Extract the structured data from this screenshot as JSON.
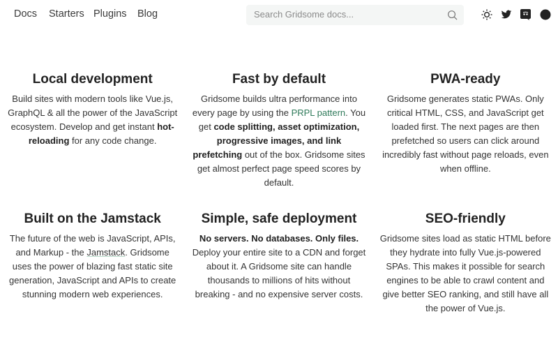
{
  "nav": {
    "links": [
      "Docs",
      "Starters",
      "Plugins",
      "Blog"
    ],
    "search_placeholder": "Search Gridsome docs..."
  },
  "colors": {
    "link": "#2f7a5a",
    "text": "#333333"
  },
  "features": [
    {
      "title": "Local development",
      "lines": [
        [
          {
            "t": "Build sites with modern tools like"
          }
        ],
        [
          {
            "t": "Vue.js, ",
            "s": ""
          },
          {
            "t": "GraphQL & all the power of"
          }
        ],
        [
          {
            "t": "the JavaScript ecosystem. Develop"
          }
        ],
        [
          {
            "t": "and get instant "
          },
          {
            "t": "hot-reloading",
            "s": "b"
          },
          {
            "t": " for any"
          }
        ],
        [
          {
            "t": "code change."
          }
        ]
      ]
    },
    {
      "title": "Fast by default",
      "lines": [
        [
          {
            "t": "Gridsome builds ultra performance into every"
          }
        ],
        [
          {
            "t": "page by using the "
          },
          {
            "t": "PRPL pattern",
            "s": "l"
          },
          {
            "t": ". You get "
          },
          {
            "t": "code",
            "s": "b"
          }
        ],
        [
          {
            "t": "splitting, asset optimization, progressive",
            "s": "b"
          }
        ],
        [
          {
            "t": "images, and link prefetching",
            "s": "b"
          },
          {
            "t": " out of the box."
          }
        ],
        [
          {
            "t": "Gridsome sites get almost perfect page speed"
          }
        ],
        [
          {
            "t": "scores by default."
          }
        ]
      ]
    },
    {
      "title": "PWA-ready",
      "lines": [
        [
          {
            "t": "Gridsome generates static PWAs. Only critical"
          }
        ],
        [
          {
            "t": "HTML, CSS, and JavaScript get loaded first."
          }
        ],
        [
          {
            "t": "The next pages are then prefetched so users"
          }
        ],
        [
          {
            "t": "can click around incredibly fast without page"
          }
        ],
        [
          {
            "t": "reloads, even when offline."
          }
        ]
      ]
    },
    {
      "title": "Built on the Jamstack",
      "lines": [
        [
          {
            "t": "The future of the web is JavaScript, APIs, and"
          }
        ],
        [
          {
            "t": "Markup - the "
          },
          {
            "t": "Jamstack",
            "s": "u"
          },
          {
            "t": ". Gridsome uses the"
          }
        ],
        [
          {
            "t": "power of blazing fast static site generation,"
          }
        ],
        [
          {
            "t": "JavaScript and APIs to create stunning modern"
          }
        ],
        [
          {
            "t": "web experiences."
          }
        ]
      ]
    },
    {
      "title": "Simple, safe deployment",
      "lines": [
        [
          {
            "t": "No servers. No databases. Only files.",
            "s": "b"
          },
          {
            "t": " Deploy"
          }
        ],
        [
          {
            "t": "your entire site to a CDN and forget about it."
          }
        ],
        [
          {
            "t": "A Gridsome site can handle thousands to"
          }
        ],
        [
          {
            "t": "millions of hits without breaking - and no"
          }
        ],
        [
          {
            "t": "expensive server costs."
          }
        ]
      ]
    },
    {
      "title": "SEO-friendly",
      "lines": [
        [
          {
            "t": "Gridsome sites load as static HTML before"
          }
        ],
        [
          {
            "t": "they hydrate into fully Vue.js-powered SPAs."
          }
        ],
        [
          {
            "t": "This makes it possible for search engines to be"
          }
        ],
        [
          {
            "t": "able to crawl content and give better SEO"
          }
        ],
        [
          {
            "t": "ranking, and still have all the power of Vue.js."
          }
        ]
      ]
    }
  ]
}
